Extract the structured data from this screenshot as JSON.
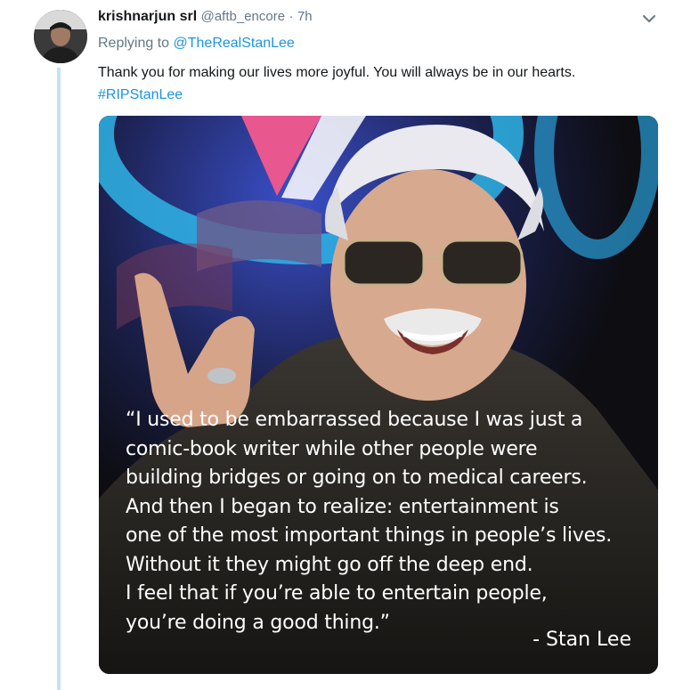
{
  "tweet": {
    "author": {
      "display_name": "krishnarjun srl",
      "handle": "@aftb_encore",
      "separator": "·",
      "time": "7h"
    },
    "replying_to": {
      "prefix": "Replying to",
      "mention": "@TheRealStanLee"
    },
    "text": "Thank you for making our lives more joyful. You will always be in our hearts.",
    "hashtag": "#RIPStanLee",
    "menu_icon": "chevron-down-icon",
    "media": {
      "quote": "“I used to be embarrassed because I was just a\ncomic-book writer while other people were\nbuilding bridges or going on to medical careers.\nAnd then I began to realize: entertainment is\none of the most important things in people’s lives.\nWithout it they might go off the deep end.\nI feel that if you’re able to entertain people,\n you’re doing a good thing.”",
      "attribution": "- Stan Lee"
    }
  },
  "colors": {
    "link": "#1b95e0",
    "muted": "#657786",
    "thread_line": "#c4e3f3",
    "text": "#14171a"
  }
}
